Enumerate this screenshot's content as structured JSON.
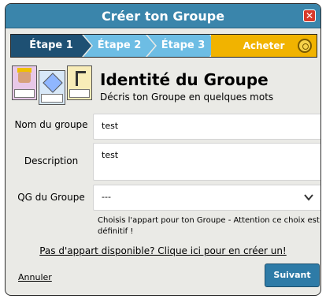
{
  "window": {
    "title": "Créer ton Groupe",
    "close_glyph": "✕"
  },
  "steps": [
    {
      "label": "Étape 1"
    },
    {
      "label": "Étape 2"
    },
    {
      "label": "Étape 3"
    },
    {
      "label": "Acheter"
    }
  ],
  "header": {
    "title": "Identité du Groupe",
    "subtitle": "Décris ton Groupe en quelques mots"
  },
  "form": {
    "name_label": "Nom du groupe",
    "name_value": "test",
    "description_label": "Description",
    "description_value": "test",
    "hq_label": "QG du Groupe",
    "hq_selected": "---",
    "hq_help": "Choisis l'appart pour ton Groupe - Attention ce choix est définitif !"
  },
  "links": {
    "create_room": "Pas d'appart disponible? Clique ici pour en créer un!",
    "cancel": "Annuler"
  },
  "buttons": {
    "next": "Suivant >>"
  }
}
